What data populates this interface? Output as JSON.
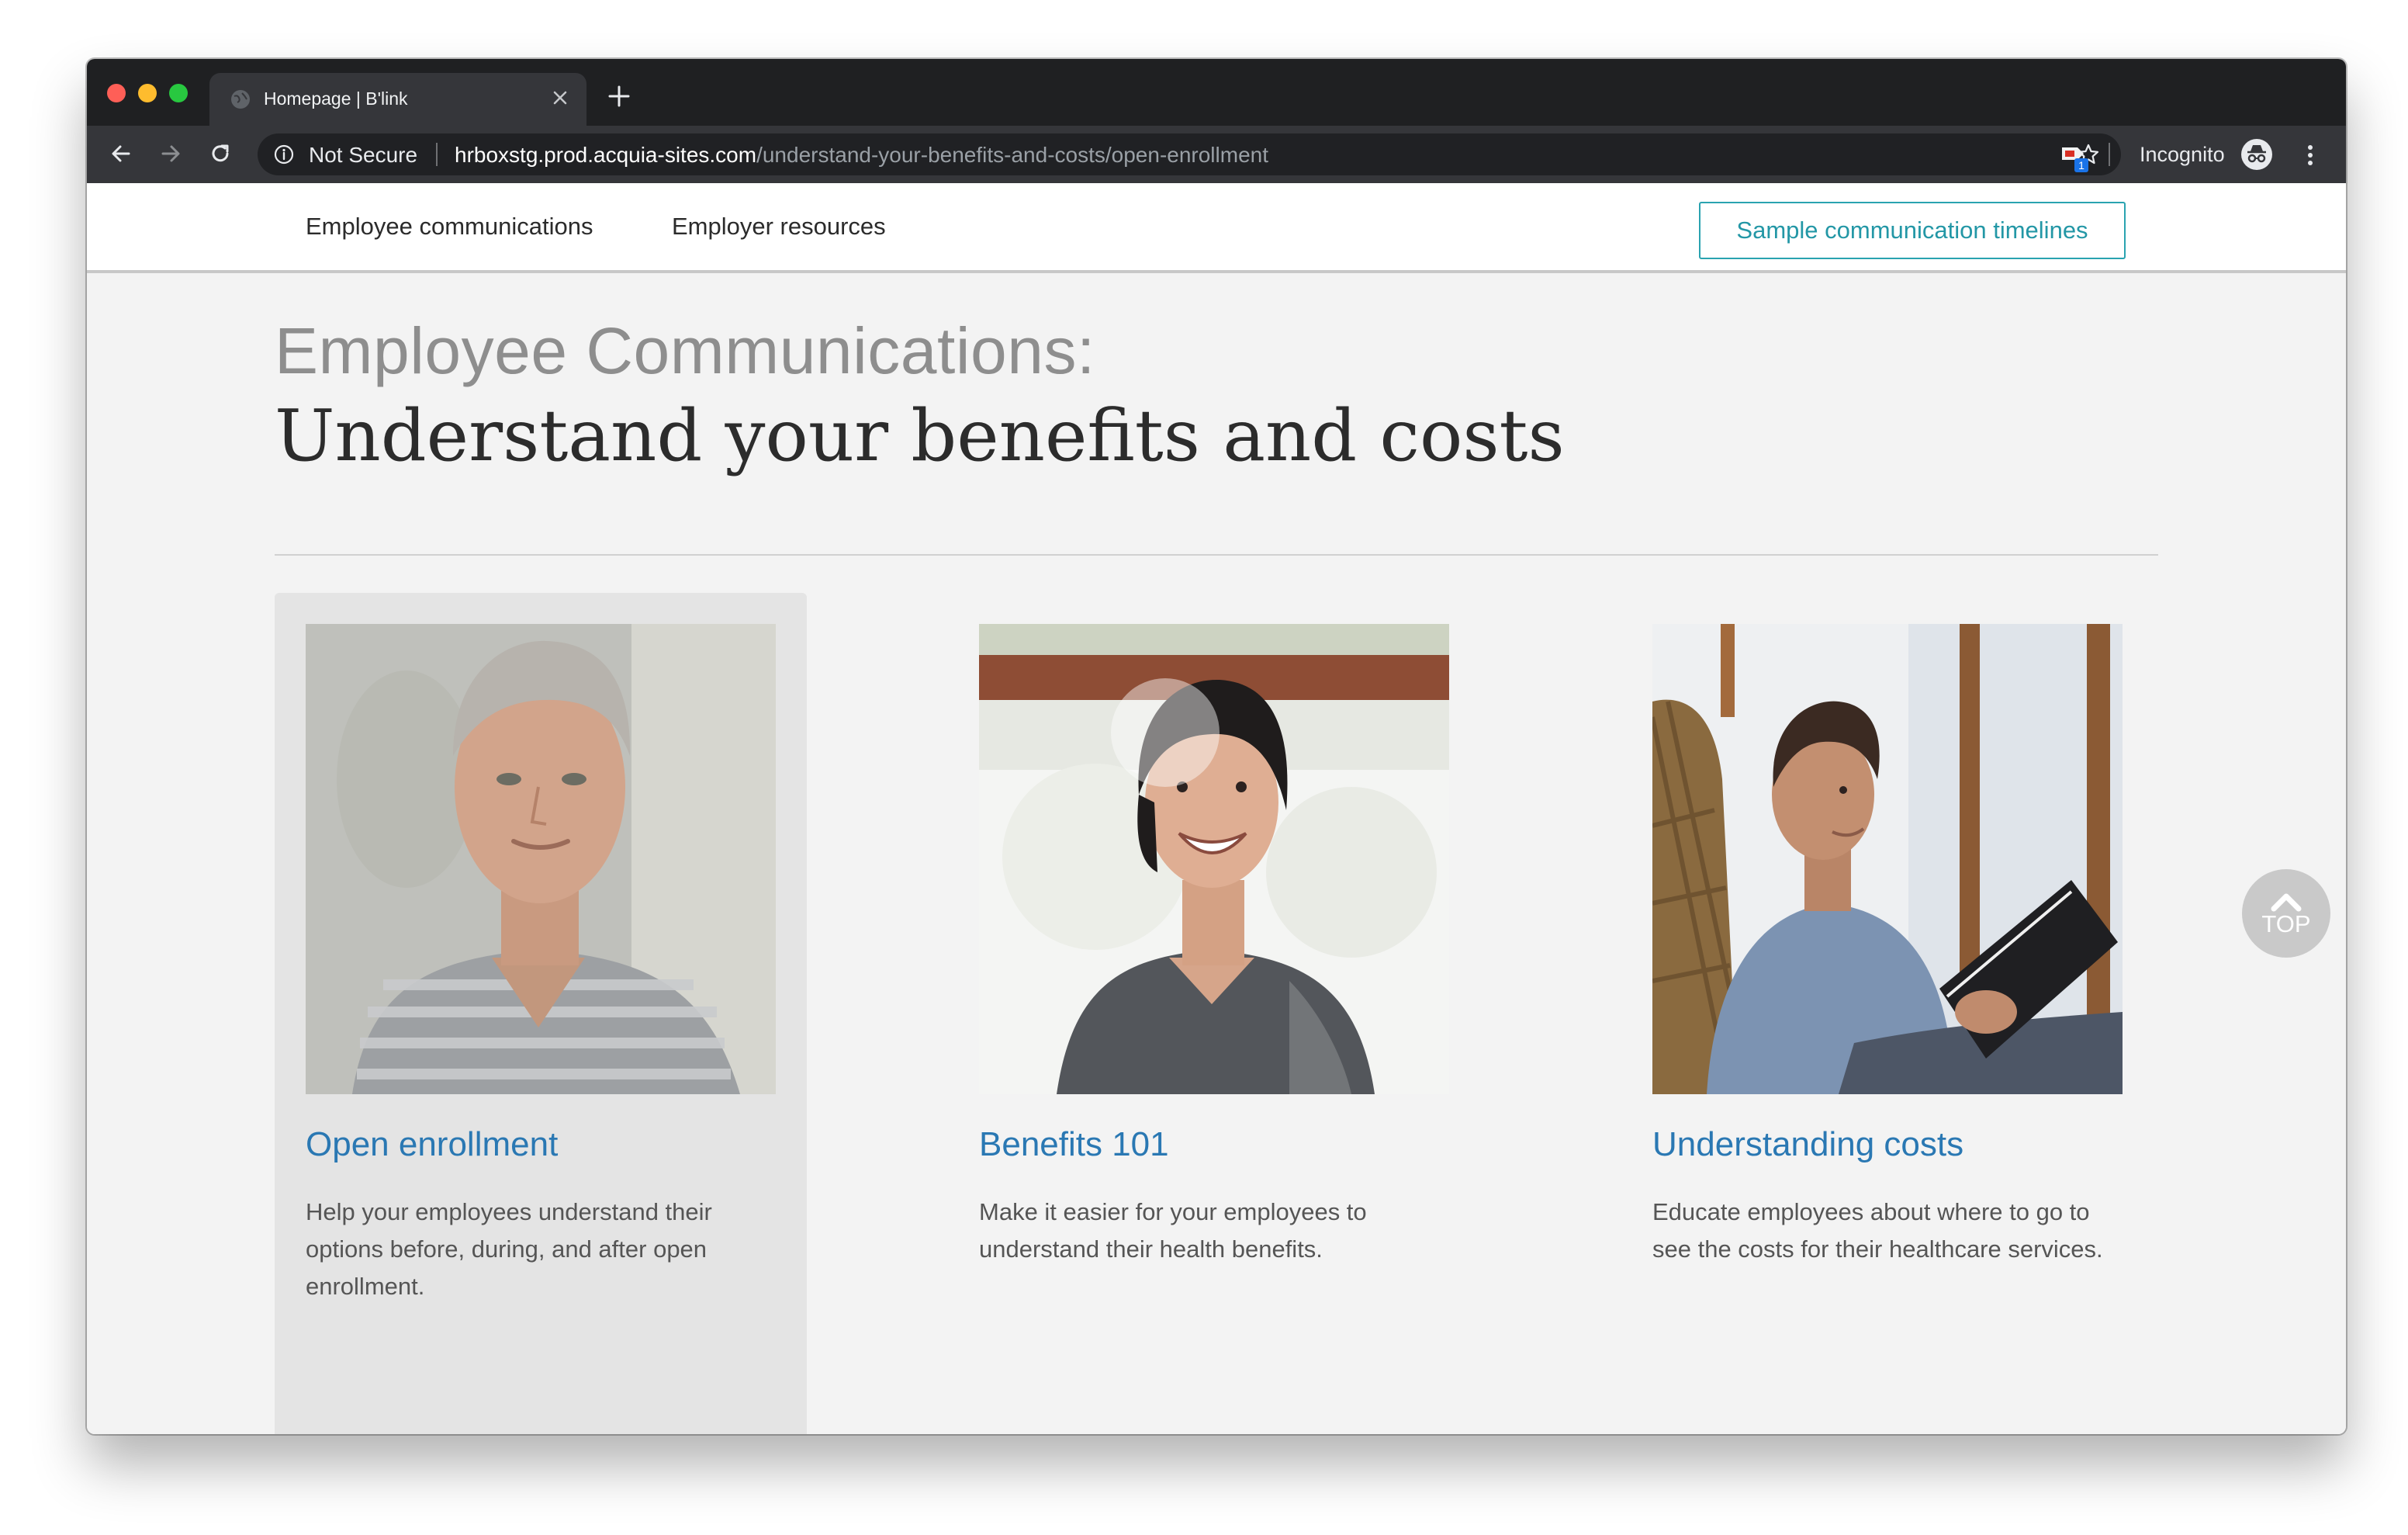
{
  "browser": {
    "tab_title": "Homepage | B'link",
    "security_label": "Not Secure",
    "url_host": "hrboxstg.prod.acquia-sites.com",
    "url_path": "/understand-your-benefits-and-costs/open-enrollment",
    "extension_badge": "1",
    "incognito_label": "Incognito"
  },
  "nav": {
    "employee_communications": "Employee communications",
    "employer_resources": "Employer resources",
    "timelines_button": "Sample communication timelines"
  },
  "page": {
    "heading_light": "Employee Communications:",
    "heading_main": "Understand your benefits and costs"
  },
  "cards": [
    {
      "title": "Open enrollment",
      "description": "Help your employees understand their options before, during, and after open enrollment."
    },
    {
      "title": "Benefits 101",
      "description": "Make it easier for your employees to understand their health benefits."
    },
    {
      "title": "Understanding costs",
      "description": "Educate employees about where to go to see the costs for their healthcare services."
    }
  ],
  "scroll_top": {
    "label": "TOP"
  },
  "colors": {
    "link_blue": "#2a78b3",
    "teal_button": "#2aa3b0",
    "active_card": "#e4e4e4",
    "page_bg": "#f3f3f3"
  }
}
